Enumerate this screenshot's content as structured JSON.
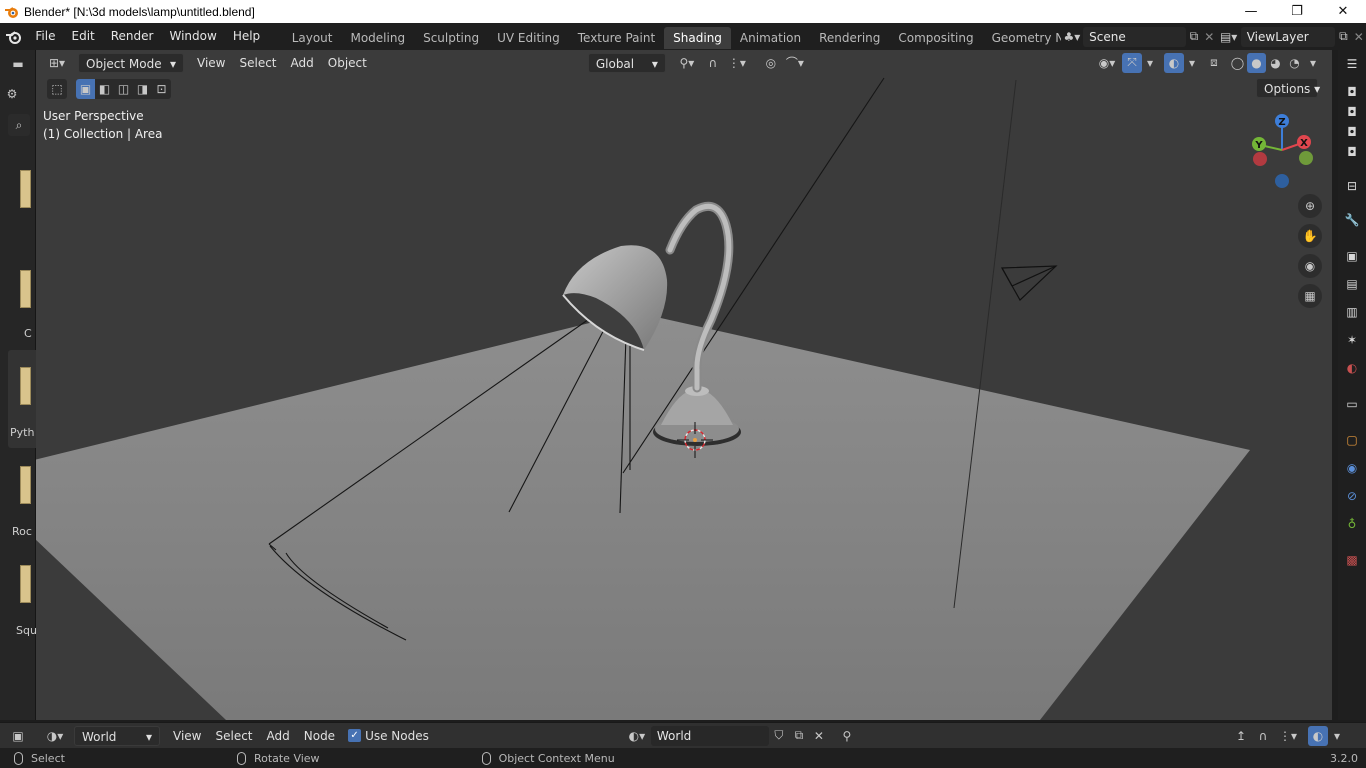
{
  "window": {
    "title": "Blender* [N:\\3d models\\lamp\\untitled.blend]",
    "minimize": "—",
    "restore": "❐",
    "close": "✕"
  },
  "topbar": {
    "menus": [
      "File",
      "Edit",
      "Render",
      "Window",
      "Help"
    ],
    "workspaces": [
      "Layout",
      "Modeling",
      "Sculpting",
      "UV Editing",
      "Texture Paint",
      "Shading",
      "Animation",
      "Rendering",
      "Compositing",
      "Geometry Noc"
    ],
    "active_workspace": "Shading",
    "scene": "Scene",
    "view_layer": "ViewLayer"
  },
  "viewport_header": {
    "mode": "Object Mode",
    "menus": [
      "View",
      "Select",
      "Add",
      "Object"
    ],
    "transform_orientation": "Global",
    "options": "Options"
  },
  "viewport_overlay": {
    "perspective": "User Perspective",
    "collection": "(1) Collection | Area"
  },
  "gizmo": {
    "z": "Z",
    "y": "Y",
    "x": "X"
  },
  "file_browser": {
    "items": [
      "",
      "C",
      "Pyth",
      "Roc",
      "Squ"
    ]
  },
  "node_editor_header": {
    "shader_type": "World",
    "menus": [
      "View",
      "Select",
      "Add",
      "Node"
    ],
    "use_nodes_label": "Use Nodes",
    "use_nodes_checked": true,
    "world_name": "World"
  },
  "statusbar": {
    "select": "Select",
    "rotate": "Rotate View",
    "context": "Object Context Menu",
    "version": "3.2.0"
  },
  "colors": {
    "accent": "#4772b3",
    "active_tab": "#3d3d3d",
    "axis_x": "#e0464e",
    "axis_y": "#74b637",
    "axis_z": "#3d7ed9"
  }
}
